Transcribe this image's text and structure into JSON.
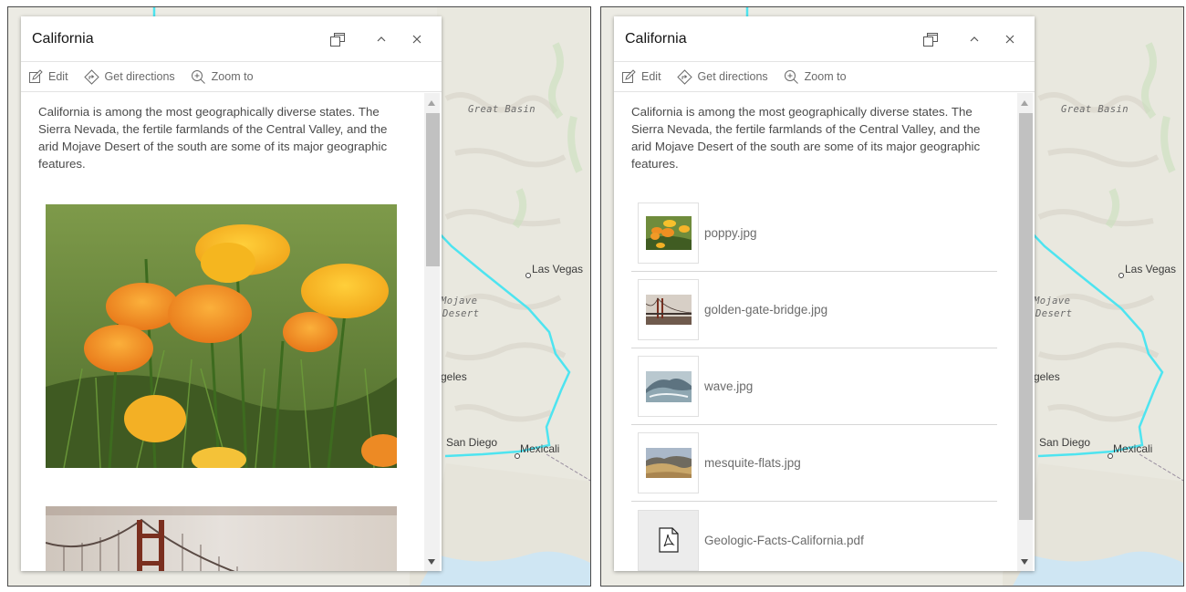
{
  "panels": [
    {
      "id": "left",
      "title": "California",
      "mode": "media",
      "actions": [
        {
          "label": "Edit",
          "icon": "edit-icon"
        },
        {
          "label": "Get directions",
          "icon": "directions-icon"
        },
        {
          "label": "Zoom to",
          "icon": "zoom-to-icon"
        }
      ],
      "description": "California is among the most geographically diverse states. The Sierra Nevada, the fertile farmlands of the Central Valley, and the arid Mojave Desert of the south are some of its major geographic features.",
      "images": [
        {
          "name": "poppy-photo"
        },
        {
          "name": "golden-gate-bridge-photo"
        }
      ]
    },
    {
      "id": "right",
      "title": "California",
      "mode": "list",
      "actions": [
        {
          "label": "Edit",
          "icon": "edit-icon"
        },
        {
          "label": "Get directions",
          "icon": "directions-icon"
        },
        {
          "label": "Zoom to",
          "icon": "zoom-to-icon"
        }
      ],
      "description": "California is among the most geographically diverse states. The Sierra Nevada, the fertile farmlands of the Central Valley, and the arid Mojave Desert of the south are some of its major geographic features.",
      "attachments": [
        {
          "name": "poppy.jpg",
          "thumb": "poppy"
        },
        {
          "name": "golden-gate-bridge.jpg",
          "thumb": "bridge"
        },
        {
          "name": "wave.jpg",
          "thumb": "wave"
        },
        {
          "name": "mesquite-flats.jpg",
          "thumb": "desert"
        },
        {
          "name": "Geologic-Facts-California.pdf",
          "thumb": "pdf-icon"
        }
      ]
    }
  ],
  "map": {
    "labels": {
      "great_basin": "Great Basin",
      "las_vegas": "Las Vegas",
      "mojave": "Mojave",
      "desert": "Desert",
      "los_angeles_fragment": "geles",
      "san_diego": "San Diego",
      "mexicali": "Mexicali"
    },
    "colors": {
      "terrain": "#ecebe4",
      "ocean": "#a9d3ec",
      "state_border": "#4ee4f0",
      "country_border": "#9a8fa0"
    }
  },
  "colors": {
    "popup_bg": "#ffffff",
    "text": "#4a4a4a",
    "muted": "#6b6b6b",
    "scroll_thumb": "#c1c1c1"
  }
}
